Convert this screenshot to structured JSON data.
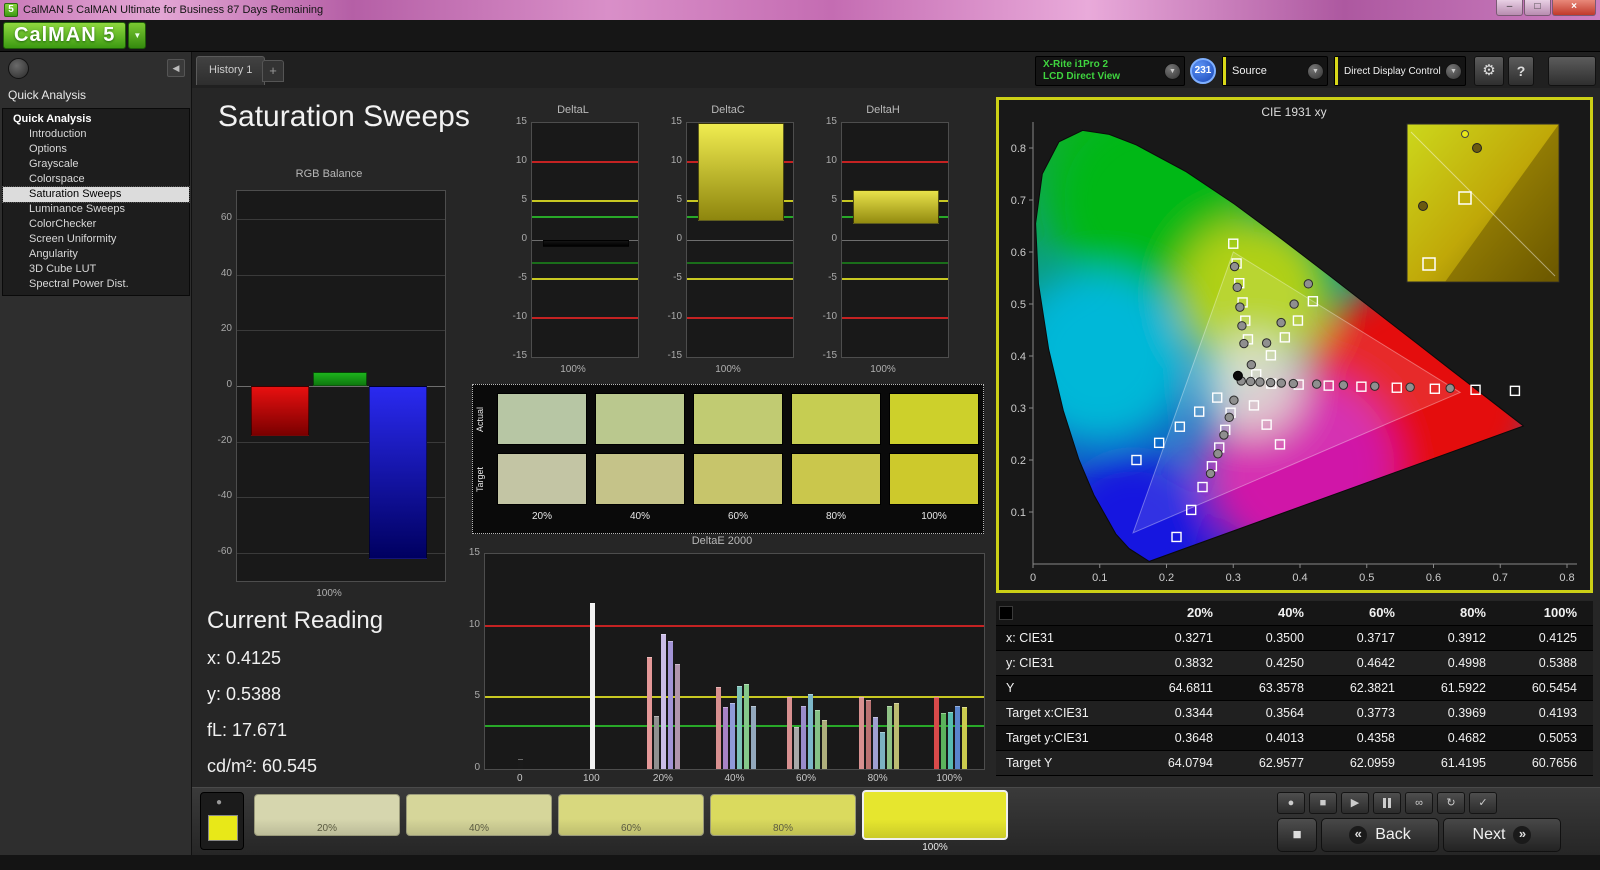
{
  "titlebar": {
    "icon_text": "5",
    "title": "CalMAN 5 CalMAN Ultimate for Business 87 Days Remaining"
  },
  "logo": {
    "text": "CalMAN 5"
  },
  "tabs": {
    "active": "History 1",
    "add": "+"
  },
  "toolbar": {
    "meter": {
      "line1": "X-Rite i1Pro 2",
      "line2": "LCD Direct View"
    },
    "badge": "231",
    "source": "Source",
    "display_control": "Direct Display Control"
  },
  "icons": {
    "minimize": "–",
    "restore": "□",
    "close": "×",
    "dropdown": "▼",
    "collapse_left": "◀",
    "record": "●",
    "stop": "■",
    "play": "▶",
    "infinity": "∞",
    "loop": "↻",
    "check": "✓",
    "gear": "⚙",
    "help": "?",
    "back_arrow": "«",
    "next_arrow": "»",
    "big_stop": "■"
  },
  "sidebar": {
    "header": "Quick Analysis",
    "items": [
      {
        "label": "Quick Analysis",
        "root": true
      },
      {
        "label": "Introduction"
      },
      {
        "label": "Options"
      },
      {
        "label": "Grayscale"
      },
      {
        "label": "Colorspace"
      },
      {
        "label": "Saturation Sweeps",
        "selected": true
      },
      {
        "label": "Luminance Sweeps"
      },
      {
        "label": "ColorChecker"
      },
      {
        "label": "Screen Uniformity"
      },
      {
        "label": "Angularity"
      },
      {
        "label": "3D Cube LUT"
      },
      {
        "label": "Spectral Power Dist."
      }
    ]
  },
  "page": {
    "title": "Saturation Sweeps"
  },
  "charts": {
    "rgb_balance": {
      "type": "bar",
      "title": "RGB Balance",
      "x_label": "100%",
      "y_ticks": [
        60,
        40,
        20,
        0,
        -20,
        -40,
        -60
      ],
      "y_range": [
        -70,
        70
      ],
      "bars": [
        {
          "name": "red",
          "value": -18,
          "color": "#e81010",
          "color2": "#7a0000"
        },
        {
          "name": "green",
          "value": 5,
          "color": "#1db31d",
          "color2": "#0e7a0e"
        },
        {
          "name": "blue",
          "value": -62,
          "color": "#2a2af0",
          "color2": "#000060"
        }
      ]
    },
    "delta": {
      "y_ticks": [
        15,
        10,
        5,
        0,
        -5,
        -10,
        -15
      ],
      "y_range": [
        -15,
        15
      ],
      "ref_lines": [
        {
          "v": 10,
          "color": "#c42222"
        },
        {
          "v": -10,
          "color": "#c42222"
        },
        {
          "v": 5,
          "color": "#c8c822"
        },
        {
          "v": -5,
          "color": "#c8c822"
        },
        {
          "v": 3,
          "color": "#28a828"
        },
        {
          "v": -3,
          "color": "#1a6e1a"
        }
      ],
      "charts": [
        {
          "title": "DeltaL",
          "x_label": "100%",
          "bar": {
            "from": -0.9,
            "to": 0,
            "color_top": "#141414",
            "color_bottom": "#000000"
          }
        },
        {
          "title": "DeltaC",
          "x_label": "100%",
          "bar": {
            "from": 2.4,
            "to": 15,
            "color_top": "#f0ec50",
            "color_bottom": "#8e860e"
          }
        },
        {
          "title": "DeltaH",
          "x_label": "100%",
          "bar": {
            "from": 2.0,
            "to": 6.4,
            "color_top": "#e8e24a",
            "color_bottom": "#938b10"
          }
        }
      ]
    },
    "deltae": {
      "type": "bar",
      "title": "DeltaE 2000",
      "y_ticks": [
        15,
        10,
        5,
        0
      ],
      "y_range": [
        0,
        15
      ],
      "ref_lines": [
        {
          "v": 10,
          "color": "#c42222"
        },
        {
          "v": 5,
          "color": "#c8c822"
        },
        {
          "v": 3,
          "color": "#28a828"
        }
      ],
      "groups": [
        {
          "tick": "0",
          "bars": [
            {
              "c": "#1a1a1a",
              "v": 0.7
            }
          ]
        },
        {
          "tick": "100",
          "bars": [
            {
              "c": "#f2f2f2",
              "v": 11.6
            }
          ]
        },
        {
          "tick": "20%",
          "bars": [
            {
              "c": "#e49898",
              "v": 7.8
            },
            {
              "c": "#909090",
              "v": 3.7
            },
            {
              "c": "#cabce6",
              "v": 9.4
            },
            {
              "c": "#a394d6",
              "v": 8.9
            },
            {
              "c": "#b295ad",
              "v": 7.3
            }
          ]
        },
        {
          "tick": "40%",
          "bars": [
            {
              "c": "#d89090",
              "v": 5.7
            },
            {
              "c": "#a883c6",
              "v": 4.3
            },
            {
              "c": "#8f9ad8",
              "v": 4.6
            },
            {
              "c": "#7cc2b8",
              "v": 5.8
            },
            {
              "c": "#85c98a",
              "v": 5.9
            },
            {
              "c": "#93a8bc",
              "v": 4.4
            }
          ]
        },
        {
          "tick": "60%",
          "bars": [
            {
              "c": "#d89090",
              "v": 5.0
            },
            {
              "c": "#a8a8a8",
              "v": 2.9
            },
            {
              "c": "#9a8cca",
              "v": 4.4
            },
            {
              "c": "#7cb7c9",
              "v": 5.2
            },
            {
              "c": "#86c286",
              "v": 4.1
            },
            {
              "c": "#aeae7c",
              "v": 3.4
            }
          ]
        },
        {
          "tick": "80%",
          "bars": [
            {
              "c": "#d89090",
              "v": 5.0
            },
            {
              "c": "#bb7272",
              "v": 4.8
            },
            {
              "c": "#a0a0d2",
              "v": 3.6
            },
            {
              "c": "#7cb2c2",
              "v": 2.6
            },
            {
              "c": "#8fc285",
              "v": 4.4
            },
            {
              "c": "#bcbc72",
              "v": 4.6
            }
          ]
        },
        {
          "tick": "100%",
          "bars": [
            {
              "c": "#d84a4a",
              "v": 5.0
            },
            {
              "c": "#5cb35c",
              "v": 3.9
            },
            {
              "c": "#57bcb0",
              "v": 4.0
            },
            {
              "c": "#5a85cc",
              "v": 4.4
            },
            {
              "c": "#cbcb4e",
              "v": 4.3
            }
          ]
        }
      ]
    },
    "cie": {
      "title": "CIE 1931 xy",
      "x_ticks": [
        "0",
        "0.1",
        "0.2",
        "0.3",
        "0.4",
        "0.5",
        "0.6",
        "0.7",
        "0.8"
      ],
      "y_ticks": [
        "0",
        "0.1",
        "0.2",
        "0.3",
        "0.4",
        "0.5",
        "0.6",
        "0.7",
        "0.8"
      ],
      "squares": [
        [
          0.357,
          0.347
        ],
        [
          0.398,
          0.345
        ],
        [
          0.443,
          0.343
        ],
        [
          0.492,
          0.341
        ],
        [
          0.545,
          0.339
        ],
        [
          0.602,
          0.337
        ],
        [
          0.663,
          0.335
        ],
        [
          0.722,
          0.333
        ],
        [
          0.322,
          0.432
        ],
        [
          0.318,
          0.468
        ],
        [
          0.314,
          0.503
        ],
        [
          0.309,
          0.54
        ],
        [
          0.305,
          0.578
        ],
        [
          0.3,
          0.616
        ],
        [
          0.3344,
          0.3648
        ],
        [
          0.3564,
          0.4013
        ],
        [
          0.3773,
          0.4358
        ],
        [
          0.3969,
          0.4682
        ],
        [
          0.4193,
          0.5053
        ],
        [
          0.296,
          0.291
        ],
        [
          0.288,
          0.258
        ],
        [
          0.279,
          0.224
        ],
        [
          0.268,
          0.188
        ],
        [
          0.254,
          0.148
        ],
        [
          0.237,
          0.104
        ],
        [
          0.215,
          0.052
        ],
        [
          0.276,
          0.32
        ],
        [
          0.249,
          0.293
        ],
        [
          0.22,
          0.264
        ],
        [
          0.189,
          0.233
        ],
        [
          0.155,
          0.2
        ],
        [
          0.331,
          0.305
        ],
        [
          0.35,
          0.268
        ],
        [
          0.37,
          0.23
        ]
      ],
      "circles": [
        [
          0.3271,
          0.3832
        ],
        [
          0.35,
          0.425
        ],
        [
          0.3717,
          0.4642
        ],
        [
          0.3912,
          0.4998
        ],
        [
          0.4125,
          0.5388
        ],
        [
          0.312,
          0.352
        ],
        [
          0.326,
          0.351
        ],
        [
          0.34,
          0.35
        ],
        [
          0.356,
          0.349
        ],
        [
          0.372,
          0.348
        ],
        [
          0.39,
          0.347
        ],
        [
          0.425,
          0.346
        ],
        [
          0.465,
          0.344
        ],
        [
          0.512,
          0.342
        ],
        [
          0.565,
          0.34
        ],
        [
          0.625,
          0.338
        ],
        [
          0.316,
          0.424
        ],
        [
          0.313,
          0.458
        ],
        [
          0.31,
          0.494
        ],
        [
          0.306,
          0.532
        ],
        [
          0.302,
          0.572
        ],
        [
          0.301,
          0.315
        ],
        [
          0.294,
          0.282
        ],
        [
          0.286,
          0.248
        ],
        [
          0.277,
          0.212
        ],
        [
          0.266,
          0.174
        ]
      ],
      "current_point": [
        0.307,
        0.362
      ]
    }
  },
  "swatch_panel": {
    "row_labels": [
      "Actual",
      "Target"
    ],
    "col_labels": [
      "20%",
      "40%",
      "60%",
      "80%",
      "100%"
    ],
    "actual": [
      "#b7c6a4",
      "#bac88e",
      "#c1cb72",
      "#c6cd52",
      "#cdd02b"
    ],
    "target": [
      "#c3c5a4",
      "#c5c389",
      "#c7c56b",
      "#cac74c",
      "#cdc92c"
    ]
  },
  "current_reading": {
    "title": "Current Reading",
    "lines": [
      "x: 0.4125",
      "y: 0.5388",
      "fL: 17.671",
      "cd/m²: 60.545"
    ]
  },
  "table": {
    "headers": [
      "",
      "20%",
      "40%",
      "60%",
      "80%",
      "100%"
    ],
    "rows": [
      {
        "label": "x: CIE31",
        "values": [
          "0.3271",
          "0.3500",
          "0.3717",
          "0.3912",
          "0.4125"
        ]
      },
      {
        "label": "y: CIE31",
        "values": [
          "0.3832",
          "0.4250",
          "0.4642",
          "0.4998",
          "0.5388"
        ]
      },
      {
        "label": "Y",
        "values": [
          "64.6811",
          "63.3578",
          "62.3821",
          "61.5922",
          "60.5454"
        ]
      },
      {
        "label": "Target x:CIE31",
        "values": [
          "0.3344",
          "0.3564",
          "0.3773",
          "0.3969",
          "0.4193"
        ]
      },
      {
        "label": "Target y:CIE31",
        "values": [
          "0.3648",
          "0.4013",
          "0.4358",
          "0.4682",
          "0.5053"
        ]
      },
      {
        "label": "Target Y",
        "values": [
          "64.0794",
          "62.9577",
          "62.0959",
          "61.4195",
          "60.7656"
        ]
      }
    ]
  },
  "bottom": {
    "indicator_color": "#e8e818",
    "swatches": [
      {
        "label": "20%",
        "color": "#d6d6ae"
      },
      {
        "label": "40%",
        "color": "#d6d69a"
      },
      {
        "label": "60%",
        "color": "#d8d87e"
      },
      {
        "label": "80%",
        "color": "#dada5e"
      },
      {
        "label": "100%",
        "color": "#e6e62e",
        "selected": true
      }
    ],
    "back": "Back",
    "next": "Next"
  }
}
